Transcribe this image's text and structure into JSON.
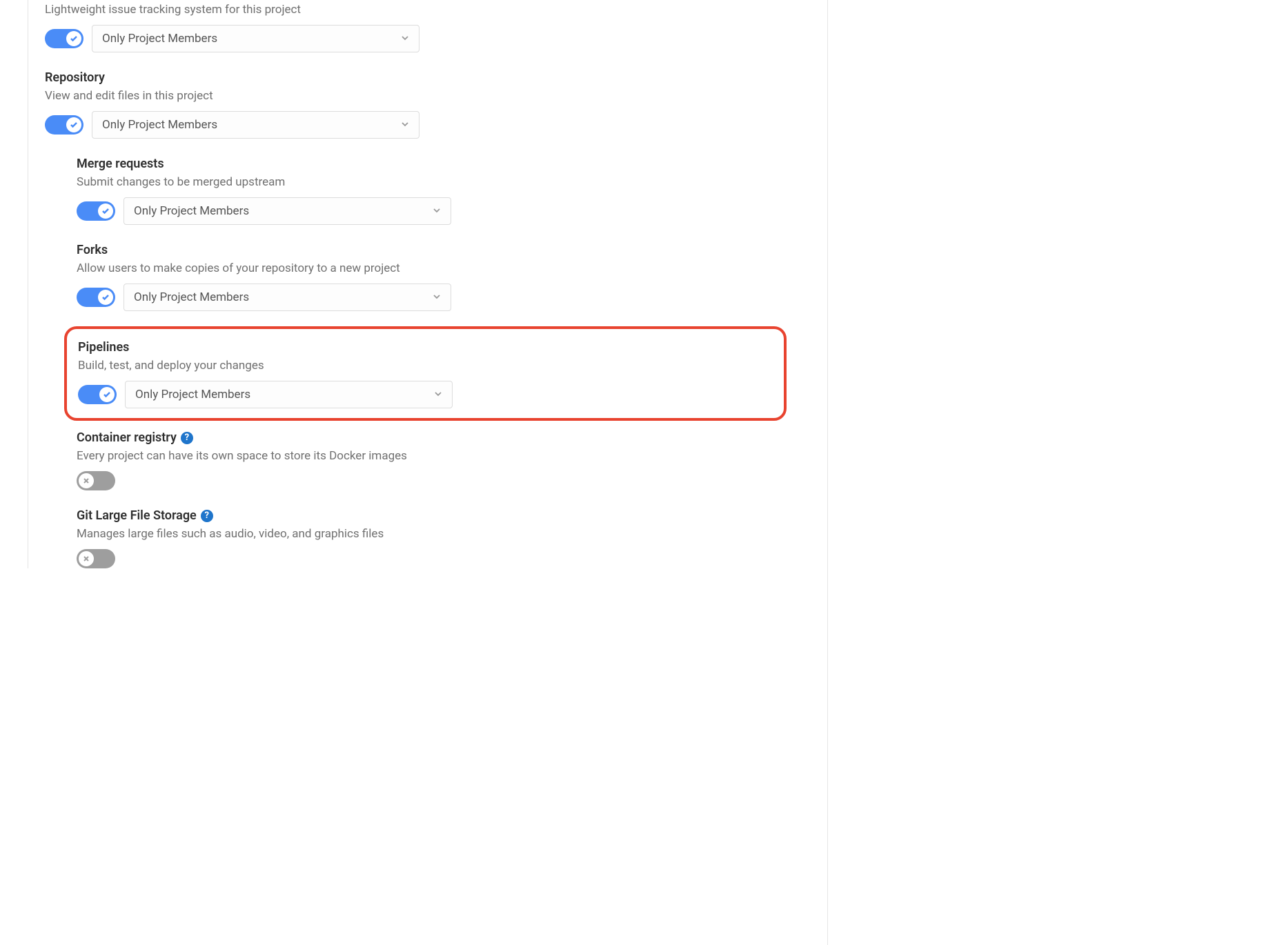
{
  "options": {
    "only_members": "Only Project Members"
  },
  "sections": {
    "issues": {
      "desc": "Lightweight issue tracking system for this project"
    },
    "repository": {
      "title": "Repository",
      "desc": "View and edit files in this project"
    },
    "merge_requests": {
      "title": "Merge requests",
      "desc": "Submit changes to be merged upstream"
    },
    "forks": {
      "title": "Forks",
      "desc": "Allow users to make copies of your repository to a new project"
    },
    "pipelines": {
      "title": "Pipelines",
      "desc": "Build, test, and deploy your changes"
    },
    "container_registry": {
      "title": "Container registry",
      "desc": "Every project can have its own space to store its Docker images"
    },
    "git_lfs": {
      "title": "Git Large File Storage",
      "desc": "Manages large files such as audio, video, and graphics files"
    }
  }
}
